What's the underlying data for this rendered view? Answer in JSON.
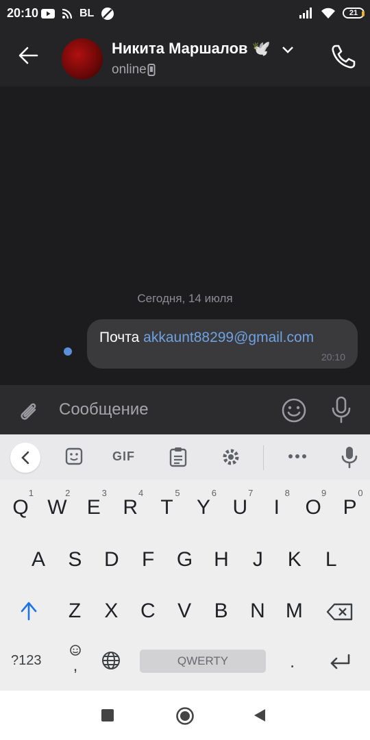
{
  "status_bar": {
    "time": "20:10",
    "carrier": "BL",
    "battery": "21"
  },
  "header": {
    "contact_name": "Никита Маршалов 🕊️",
    "status": "online"
  },
  "chat": {
    "date_separator": "Сегодня, 14 июля",
    "messages": [
      {
        "text_prefix": "Почта ",
        "email": "akkaunt88299@gmail.com",
        "time": "20:10"
      }
    ]
  },
  "input": {
    "placeholder": "Сообщение"
  },
  "keyboard": {
    "toolbar_gif": "GIF",
    "row1": [
      {
        "label": "Q",
        "sup": "1"
      },
      {
        "label": "W",
        "sup": "2"
      },
      {
        "label": "E",
        "sup": "3"
      },
      {
        "label": "R",
        "sup": "4"
      },
      {
        "label": "T",
        "sup": "5"
      },
      {
        "label": "Y",
        "sup": "6"
      },
      {
        "label": "U",
        "sup": "7"
      },
      {
        "label": "I",
        "sup": "8"
      },
      {
        "label": "O",
        "sup": "9"
      },
      {
        "label": "P",
        "sup": "0"
      }
    ],
    "row2": [
      "A",
      "S",
      "D",
      "F",
      "G",
      "H",
      "J",
      "K",
      "L"
    ],
    "row3": [
      "Z",
      "X",
      "C",
      "V",
      "B",
      "N",
      "M"
    ],
    "symbols_key": "?123",
    "comma_key": ",",
    "space_label": "QWERTY",
    "period_key": "."
  }
}
